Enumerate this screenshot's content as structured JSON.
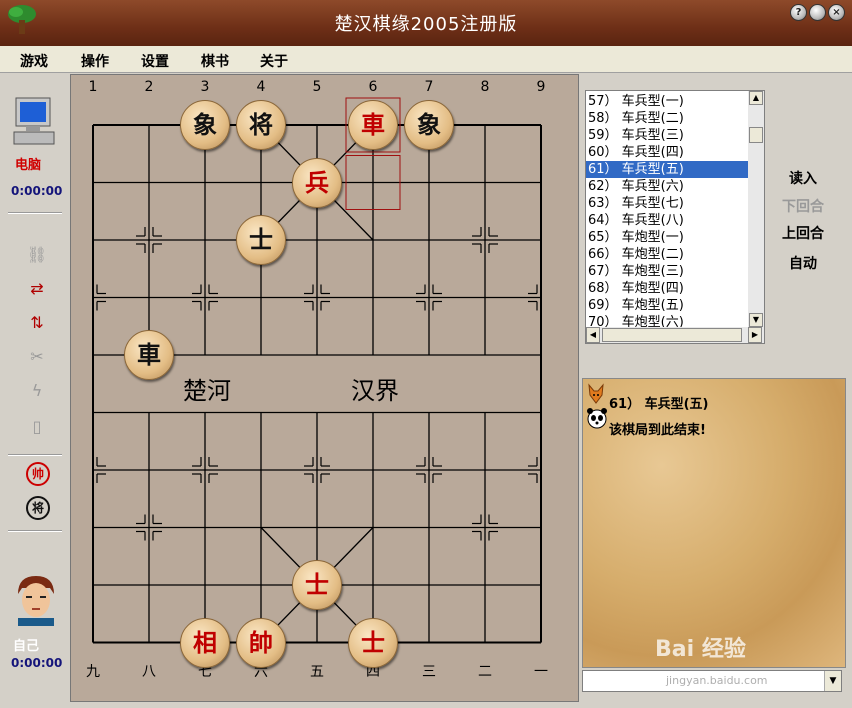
{
  "window": {
    "title": "楚汉棋缘2005注册版",
    "buttons": {
      "help": "?",
      "minimize": "",
      "close": "×"
    }
  },
  "menu": [
    "游戏",
    "操作",
    "设置",
    "棋书",
    "关于"
  ],
  "left": {
    "computer_label": "电脑",
    "computer_time": "0:00:00",
    "self_label": "自己",
    "self_time": "0:00:00",
    "red_king_label": "帅",
    "black_king_label": "将"
  },
  "board": {
    "top_numbers": [
      "1",
      "2",
      "3",
      "4",
      "5",
      "6",
      "7",
      "8",
      "9"
    ],
    "bottom_numbers": [
      "九",
      "八",
      "七",
      "六",
      "五",
      "四",
      "三",
      "二",
      "一"
    ],
    "river_left": "楚河",
    "river_right": "汉界",
    "pieces": [
      {
        "char": "象",
        "color": "b"
      },
      {
        "char": "将",
        "color": "b"
      },
      {
        "char": "車",
        "color": "r"
      },
      {
        "char": "象",
        "color": "b"
      },
      {
        "char": "兵",
        "color": "r"
      },
      {
        "char": "士",
        "color": "b"
      },
      {
        "char": "車",
        "color": "b"
      },
      {
        "char": "士",
        "color": "r"
      },
      {
        "char": "相",
        "color": "r"
      },
      {
        "char": "帥",
        "color": "r"
      },
      {
        "char": "士",
        "color": "r"
      }
    ]
  },
  "list": {
    "items": [
      "57） 车兵型(一)",
      "58） 车兵型(二)",
      "59） 车兵型(三)",
      "60） 车兵型(四)",
      "61） 车兵型(五)",
      "62） 车兵型(六)",
      "63） 车兵型(七)",
      "64） 车兵型(八)",
      "65） 车炮型(一)",
      "66） 车炮型(二)",
      "67） 车炮型(三)",
      "68） 车炮型(四)",
      "69） 车炮型(五)",
      "70） 车炮型(六)"
    ],
    "selected_index": 4
  },
  "controls": {
    "load": "读入",
    "prev": "下回合",
    "next": "上回合",
    "auto": "自动"
  },
  "messages": {
    "line1": "61） 车兵型(五)",
    "line2": "该棋局到此结束!"
  },
  "watermark": {
    "brand": "Bai 经验",
    "url": "jingyan.baidu.com"
  }
}
